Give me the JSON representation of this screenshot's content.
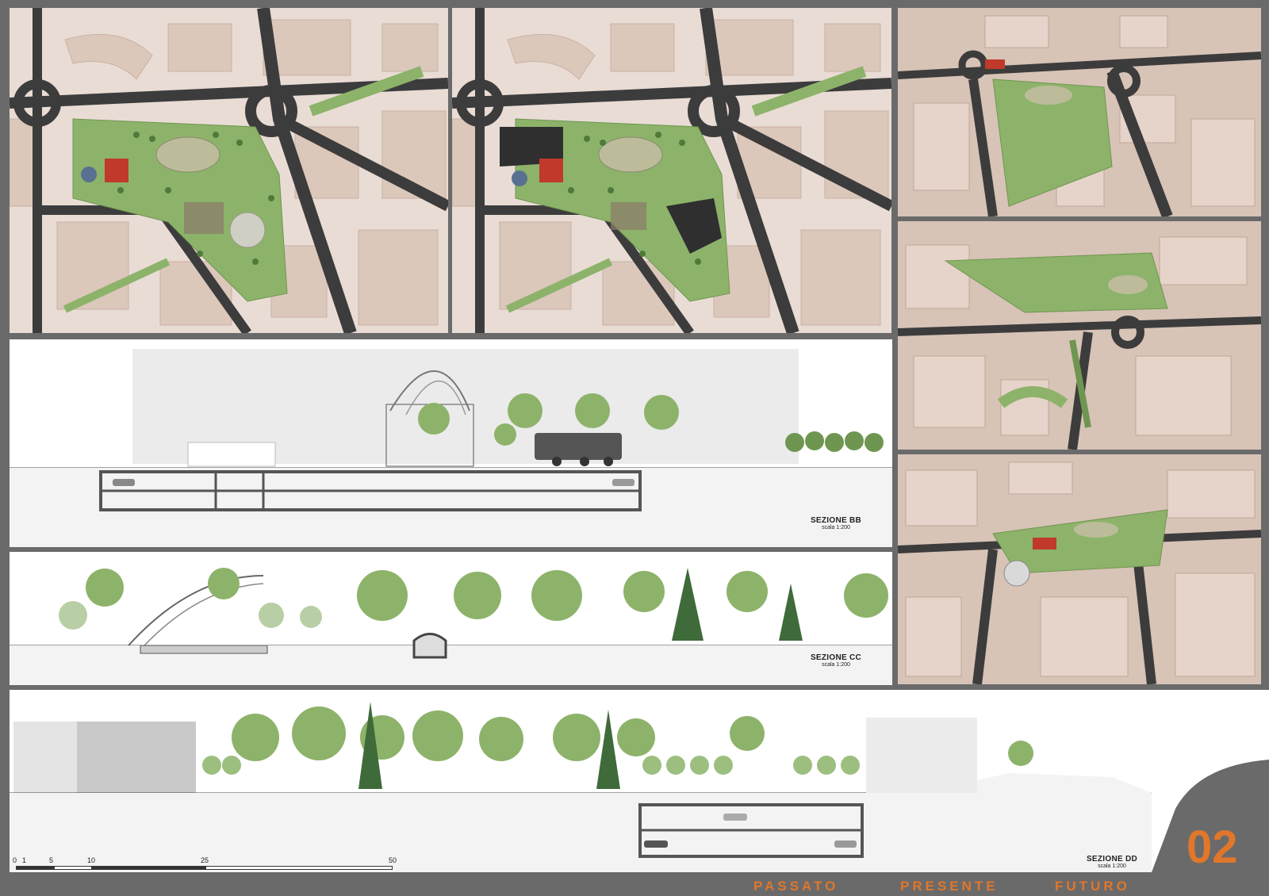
{
  "sheet_number": "02",
  "footer": {
    "word1": "PASSATO",
    "word2": "PRESENTE",
    "word3": "FUTURO"
  },
  "sections": {
    "bb": {
      "title": "SEZIONE BB",
      "scale": "scala 1:200"
    },
    "cc": {
      "title": "SEZIONE CC",
      "scale": "scala 1:200"
    },
    "dd": {
      "title": "SEZIONE DD",
      "scale": "scala 1:200"
    }
  },
  "scale_bar": {
    "marks": [
      "0",
      "1",
      "5",
      "10",
      "25",
      "50"
    ]
  },
  "colors": {
    "frame": "#6a6a6a",
    "accent": "#e0772a",
    "building": "#dcc7bb",
    "road": "#3c3c3c",
    "park": "#8db36a"
  }
}
